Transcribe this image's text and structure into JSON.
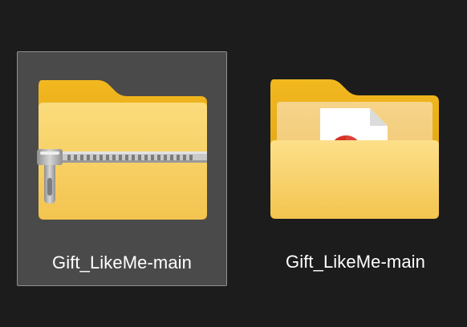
{
  "items": [
    {
      "name": "Gift_LikeMe-main",
      "icon": "zip-folder-icon",
      "selected": true
    },
    {
      "name": "Gift_LikeMe-main",
      "icon": "folder-with-document-icon",
      "selected": false
    }
  ],
  "colors": {
    "background": "#1c1c1c",
    "selection_fill": "#4a4a4a",
    "selection_border": "#8f8f8f",
    "folder_back": "#e8a815",
    "folder_front": "#f8d36a",
    "zipper": "#b9b9b9",
    "text": "#ffffff"
  }
}
